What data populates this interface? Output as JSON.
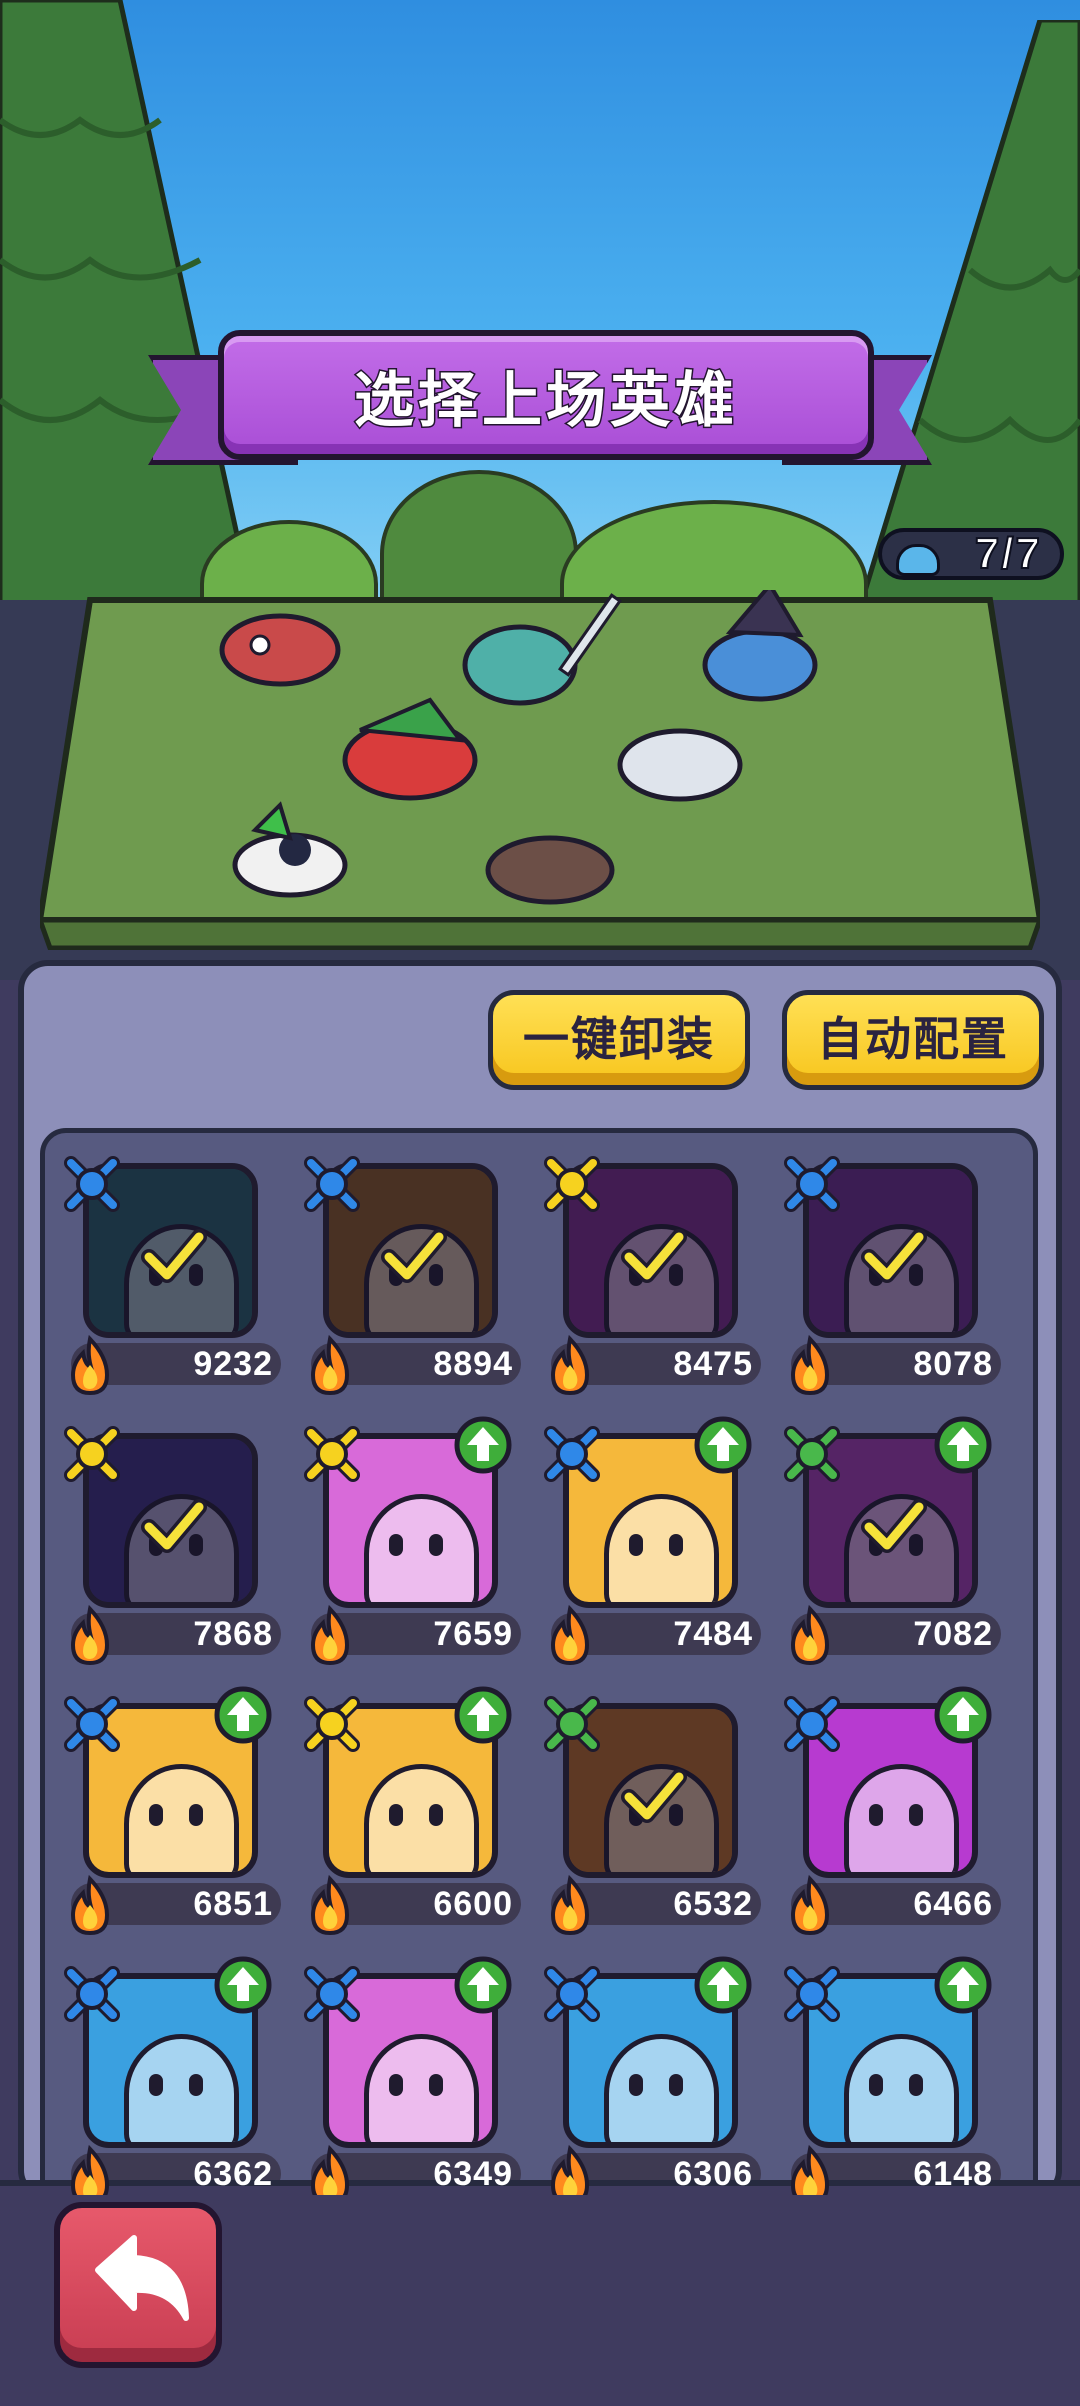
{
  "header": {
    "title": "选择上场英雄",
    "team_count": "7/7"
  },
  "actions": {
    "unequip_all": "一键卸装",
    "auto_config": "自动配置"
  },
  "heroes": [
    {
      "power": "9232",
      "class": "blue",
      "selected": true,
      "upgrade": false,
      "color": "#245d62"
    },
    {
      "power": "8894",
      "class": "blue",
      "selected": true,
      "upgrade": false,
      "color": "#8b5a1e"
    },
    {
      "power": "8475",
      "class": "yellow",
      "selected": true,
      "upgrade": false,
      "color": "#7b2b86"
    },
    {
      "power": "8078",
      "class": "blue",
      "selected": true,
      "upgrade": false,
      "color": "#6b2d88"
    },
    {
      "power": "7868",
      "class": "yellow",
      "selected": true,
      "upgrade": false,
      "color": "#3b2f7a"
    },
    {
      "power": "7659",
      "class": "yellow",
      "selected": false,
      "upgrade": true,
      "color": "#d86ad9"
    },
    {
      "power": "7484",
      "class": "blue",
      "selected": false,
      "upgrade": true,
      "color": "#f5b83b"
    },
    {
      "power": "7082",
      "class": "green",
      "selected": true,
      "upgrade": true,
      "color": "#a53db0"
    },
    {
      "power": "6851",
      "class": "blue",
      "selected": false,
      "upgrade": true,
      "color": "#f5b83b"
    },
    {
      "power": "6600",
      "class": "yellow",
      "selected": false,
      "upgrade": true,
      "color": "#f5b83b"
    },
    {
      "power": "6532",
      "class": "green",
      "selected": true,
      "upgrade": false,
      "color": "#b86a21"
    },
    {
      "power": "6466",
      "class": "blue",
      "selected": false,
      "upgrade": true,
      "color": "#b73ad0"
    },
    {
      "power": "6362",
      "class": "blue",
      "selected": false,
      "upgrade": true,
      "color": "#3aa0e0"
    },
    {
      "power": "6349",
      "class": "blue",
      "selected": false,
      "upgrade": true,
      "color": "#d86ad9"
    },
    {
      "power": "6306",
      "class": "blue",
      "selected": false,
      "upgrade": true,
      "color": "#3aa0e0"
    },
    {
      "power": "6148",
      "class": "blue",
      "selected": false,
      "upgrade": true,
      "color": "#3aa0e0"
    }
  ],
  "colors": {
    "accent_purple": "#a94ed6",
    "button_yellow": "#f7c51c",
    "back_red": "#c83d52",
    "upgrade_green": "#3fae3a"
  }
}
